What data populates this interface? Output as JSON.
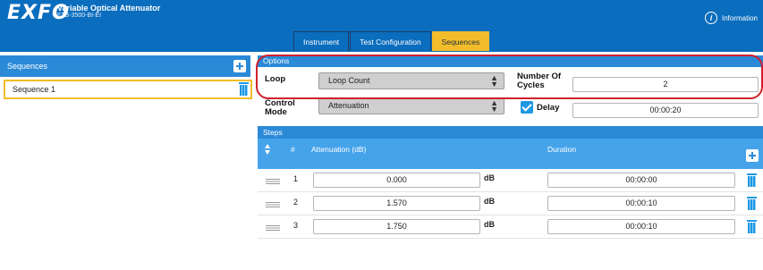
{
  "header": {
    "logo": "EXFO",
    "app_title": "Variable Optical Attenuator",
    "app_subtitle": "FTB-3500-BI-EI",
    "info_label": "Information"
  },
  "tabs": [
    {
      "label": "Instrument",
      "active": false
    },
    {
      "label": "Test Configuration",
      "active": false
    },
    {
      "label": "Sequences",
      "active": true
    }
  ],
  "sequences": {
    "title": "Sequences",
    "items": [
      {
        "label": "Sequence 1",
        "selected": true
      }
    ]
  },
  "options": {
    "title": "Options",
    "loop_label": "Loop",
    "loop_value": "Loop Count",
    "cycles_label_line1": "Number Of",
    "cycles_label_line2": "Cycles",
    "cycles_value": "2",
    "control_label_line1": "Control",
    "control_label_line2": "Mode",
    "control_value": "Attenuation",
    "delay_label": "Delay",
    "delay_checked": true,
    "delay_value": "00:00:20"
  },
  "steps": {
    "title": "Steps",
    "col_num": "#",
    "col_att": "Attenuation (dB)",
    "col_dur": "Duration",
    "unit": "dB",
    "rows": [
      {
        "num": "1",
        "attenuation": "0.000",
        "duration": "00:00:00"
      },
      {
        "num": "2",
        "attenuation": "1.570",
        "duration": "00:00:10"
      },
      {
        "num": "3",
        "attenuation": "1.750",
        "duration": "00:00:10"
      }
    ]
  },
  "colors": {
    "header_blue": "#0a6dbd",
    "panel_blue": "#2a8ad8",
    "accent_yellow": "#f2bd2a",
    "highlight_red": "#d0202a"
  }
}
